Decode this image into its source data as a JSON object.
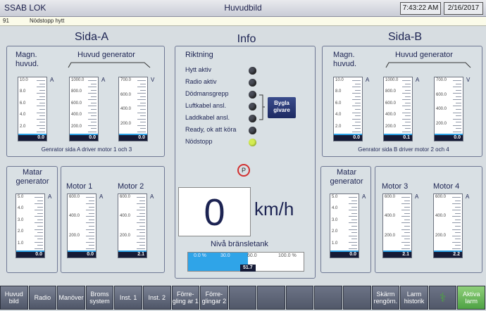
{
  "titlebar": {
    "app": "SSAB LOK",
    "screen": "Huvudbild",
    "time": "7:43:22 AM",
    "date": "2/16/2017"
  },
  "alarm": {
    "code": "91",
    "text": "Nödstopp hytt"
  },
  "side_a": {
    "title": "Sida-A",
    "magn_label": "Magn.\nhuvud.",
    "gen_label": "Huvud generator",
    "caption": "Genrator sida A driver motor 1 och 3",
    "matar_label": "Matar\ngenerator",
    "motor1_label": "Motor 1",
    "motor2_label": "Motor 2"
  },
  "side_b": {
    "title": "Sida-B",
    "magn_label": "Magn.\nhuvud.",
    "gen_label": "Huvud generator",
    "caption": "Genrator sida B driver motor 2 och 4",
    "matar_label": "Matar\ngenerator",
    "motor3_label": "Motor 3",
    "motor4_label": "Motor 4"
  },
  "info": {
    "title": "Info",
    "riktning": "Riktning",
    "items": [
      "Hytt aktiv",
      "Radio aktiv",
      "Dödmansgrepp",
      "Luftkabel ansl.",
      "Laddkabel ansl.",
      "Ready, ok att köra",
      "Nödstopp"
    ],
    "led_on": [
      false,
      false,
      false,
      false,
      false,
      false,
      true
    ],
    "bygla": "Bygla\ngivare",
    "parking": "P",
    "speed": "0",
    "speed_unit": "km/h",
    "fuel_label": "Nivå bränsletank",
    "fuel_ticks": [
      "0.0 %",
      "30.0",
      "60.0",
      "100.0 %"
    ],
    "fuel_value": "51.7",
    "fuel_fraction": 0.517
  },
  "gauges": {
    "a_magn": {
      "ticks": [
        "10.0",
        "8.0",
        "6.0",
        "4.0",
        "2.0"
      ],
      "unit": "A",
      "value": "0.0",
      "fraction": 0
    },
    "a_gen_a": {
      "ticks": [
        "1000.0",
        "800.0",
        "600.0",
        "400.0",
        "200.0"
      ],
      "unit": "A",
      "value": "0.0",
      "fraction": 0
    },
    "a_gen_v": {
      "ticks": [
        "700.0",
        "600.0",
        "400.0",
        "200.0"
      ],
      "unit": "V",
      "value": "0.0",
      "fraction": 0
    },
    "a_matar": {
      "ticks": [
        "5.0",
        "4.0",
        "3.0",
        "2.0",
        "1.0"
      ],
      "unit": "A",
      "value": "0.0",
      "fraction": 0
    },
    "a_m1": {
      "ticks": [
        "600.0",
        "400.0",
        "200.0"
      ],
      "unit": "A",
      "value": "0.0",
      "fraction": 0
    },
    "a_m2": {
      "ticks": [
        "600.0",
        "400.0",
        "200.0"
      ],
      "unit": "A",
      "value": "2.1",
      "fraction": 0.01
    },
    "b_magn": {
      "ticks": [
        "10.0",
        "8.0",
        "6.0",
        "4.0",
        "2.0"
      ],
      "unit": "A",
      "value": "0.0",
      "fraction": 0
    },
    "b_gen_a": {
      "ticks": [
        "1000.0",
        "800.0",
        "600.0",
        "400.0",
        "200.0"
      ],
      "unit": "A",
      "value": "0.1",
      "fraction": 0
    },
    "b_gen_v": {
      "ticks": [
        "700.0",
        "600.0",
        "400.0",
        "200.0"
      ],
      "unit": "V",
      "value": "0.0",
      "fraction": 0
    },
    "b_matar": {
      "ticks": [
        "5.0",
        "4.0",
        "3.0",
        "2.0",
        "1.0"
      ],
      "unit": "A",
      "value": "0.0",
      "fraction": 0
    },
    "b_m3": {
      "ticks": [
        "600.0",
        "400.0",
        "200.0"
      ],
      "unit": "A",
      "value": "2.1",
      "fraction": 0.01
    },
    "b_m4": {
      "ticks": [
        "600.0",
        "400.0",
        "200.0"
      ],
      "unit": "A",
      "value": "2.2",
      "fraction": 0.01
    }
  },
  "nav": [
    "Huvud\nbild",
    "Radio",
    "Manöver",
    "Broms\nsystem",
    "Inst. 1",
    "Inst. 2",
    "Förre-\ngling ar 1",
    "Förre-\nglingar 2",
    "",
    "",
    "",
    "",
    "",
    "Skärm\nrengörn.",
    "Larm\nhistorik",
    "",
    "Aktiva\nlarm"
  ],
  "colors": {
    "fill": "#2fa4e8",
    "led_on": "#d4ec52",
    "panel": "#d9e0e4"
  }
}
